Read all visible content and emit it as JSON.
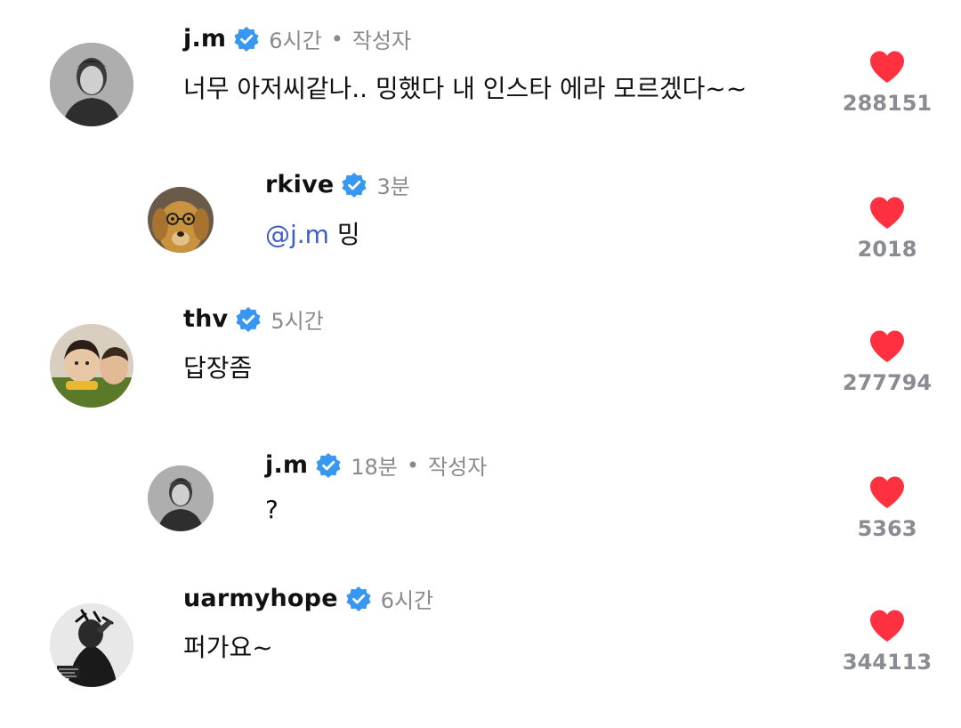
{
  "colors": {
    "heart": "#ff3040",
    "verified": "#3897f0",
    "mention": "#3d5dc8",
    "meta_text": "#8a8a8a",
    "count_text": "#8b8b93"
  },
  "comments": [
    {
      "username": "j.m",
      "verified": true,
      "time": "6시간",
      "separator": "•",
      "author_tag": "작성자",
      "text": "너무 아저씨같나.. 밍했다 내 인스타 에라 모르겠다~~",
      "likes": "288151",
      "avatar_icon": "grayscale-portrait-avatar"
    },
    {
      "username": "rkive",
      "verified": true,
      "time": "3분",
      "mention": "@j.m",
      "text": " 밍",
      "likes": "2018",
      "avatar_icon": "dog-with-glasses-avatar"
    },
    {
      "username": "thv",
      "verified": true,
      "time": "5시간",
      "text": "답장좀",
      "likes": "277794",
      "avatar_icon": "child-photo-avatar"
    },
    {
      "username": "j.m",
      "verified": true,
      "time": "18분",
      "separator": "•",
      "author_tag": "작성자",
      "text": "?",
      "likes": "5363",
      "avatar_icon": "grayscale-portrait-avatar"
    },
    {
      "username": "uarmyhope",
      "verified": true,
      "time": "6시간",
      "text": "퍼가요~",
      "likes": "344113",
      "avatar_icon": "dark-artistic-avatar"
    }
  ]
}
